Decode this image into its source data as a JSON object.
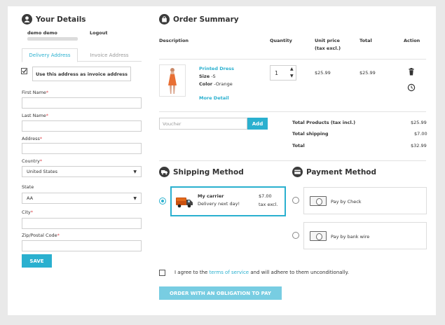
{
  "details": {
    "title": "Your Details",
    "user_name": "demo demo",
    "user_email": "",
    "logout": "Logout",
    "tabs": [
      "Delivery Address",
      "Invoice Address"
    ],
    "use_invoice": "Use this address as invoice address",
    "first_name": "First Name",
    "last_name": "Last Name",
    "address": "Address",
    "country": "Country",
    "country_value": "United States",
    "state": "State",
    "state_value": "AA",
    "city": "City",
    "zip": "Zip/Postal Code",
    "required_mark": "*",
    "save": "SAVE"
  },
  "order": {
    "title": "Order Summary",
    "columns": {
      "description": "Description",
      "quantity": "Quantity",
      "unit_price": "Unit price",
      "unit_price_sub": "(tax excl.)",
      "total": "Total",
      "action": "Action"
    },
    "item": {
      "name": "Printed Dress",
      "size_label": "Size",
      "size_value": "-S",
      "color_label": "Color",
      "color_value": "-Orange",
      "more": "More Detail",
      "quantity": "1",
      "unit_price": "$25.99",
      "total": "$25.99"
    },
    "voucher_placeholder": "Voucher",
    "voucher_add": "Add",
    "totals": [
      {
        "label": "Total Products (tax incl.)",
        "value": "$25.99"
      },
      {
        "label": "Total shipping",
        "value": "$7.00"
      },
      {
        "label": "Total",
        "value": "$32.99"
      }
    ]
  },
  "shipping": {
    "title": "Shipping Method",
    "carrier_name": "My carrier",
    "carrier_desc": "Delivery next day!",
    "price": "$7.00",
    "price_sub": "tax excl."
  },
  "payment": {
    "title": "Payment Method",
    "options": [
      "Pay by Check",
      "Pay by bank wire"
    ]
  },
  "terms": {
    "prefix": "I agree to the",
    "link": "terms of service",
    "suffix": "and will adhere to them unconditionally."
  },
  "order_button": "ORDER WITH AN OBLIGATION TO PAY",
  "colors": {
    "accent": "#2ab0cf",
    "button_disabled": "#78cde2",
    "required": "#e0494f",
    "carrier_border": "#2ab0cf"
  }
}
